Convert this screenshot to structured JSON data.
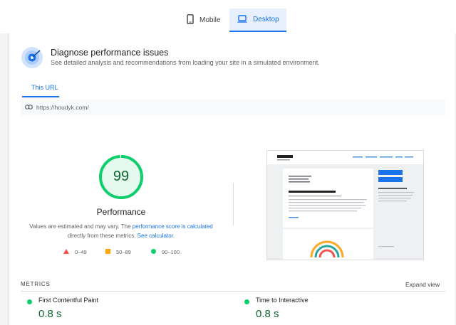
{
  "tabs": {
    "mobile": "Mobile",
    "desktop": "Desktop"
  },
  "diagnose": {
    "title": "Diagnose performance issues",
    "subtitle": "See detailed analysis and recommendations from loading your site in a simulated environment."
  },
  "url_tab": "This URL",
  "url": "https://houdyk.com/",
  "performance": {
    "score": "99",
    "score_fraction": 0.99,
    "label": "Performance",
    "note_pre": "Values are estimated and may vary. The ",
    "note_link1": "performance score is calculated",
    "note_mid": " directly from these metrics. ",
    "note_link2": "See calculator",
    "note_end": "."
  },
  "legend": {
    "red": "0–49",
    "orange": "50–89",
    "green": "90–100"
  },
  "metrics": {
    "header": "METRICS",
    "expand": "Expand view",
    "fcp": {
      "name": "First Contentful Paint",
      "value": "0.8 s"
    },
    "tti": {
      "name": "Time to Interactive",
      "value": "0.8 s"
    }
  },
  "colors": {
    "accent": "#1a73e8",
    "good": "#0cce6b",
    "average": "#ffa400",
    "poor": "#ff4e42"
  }
}
